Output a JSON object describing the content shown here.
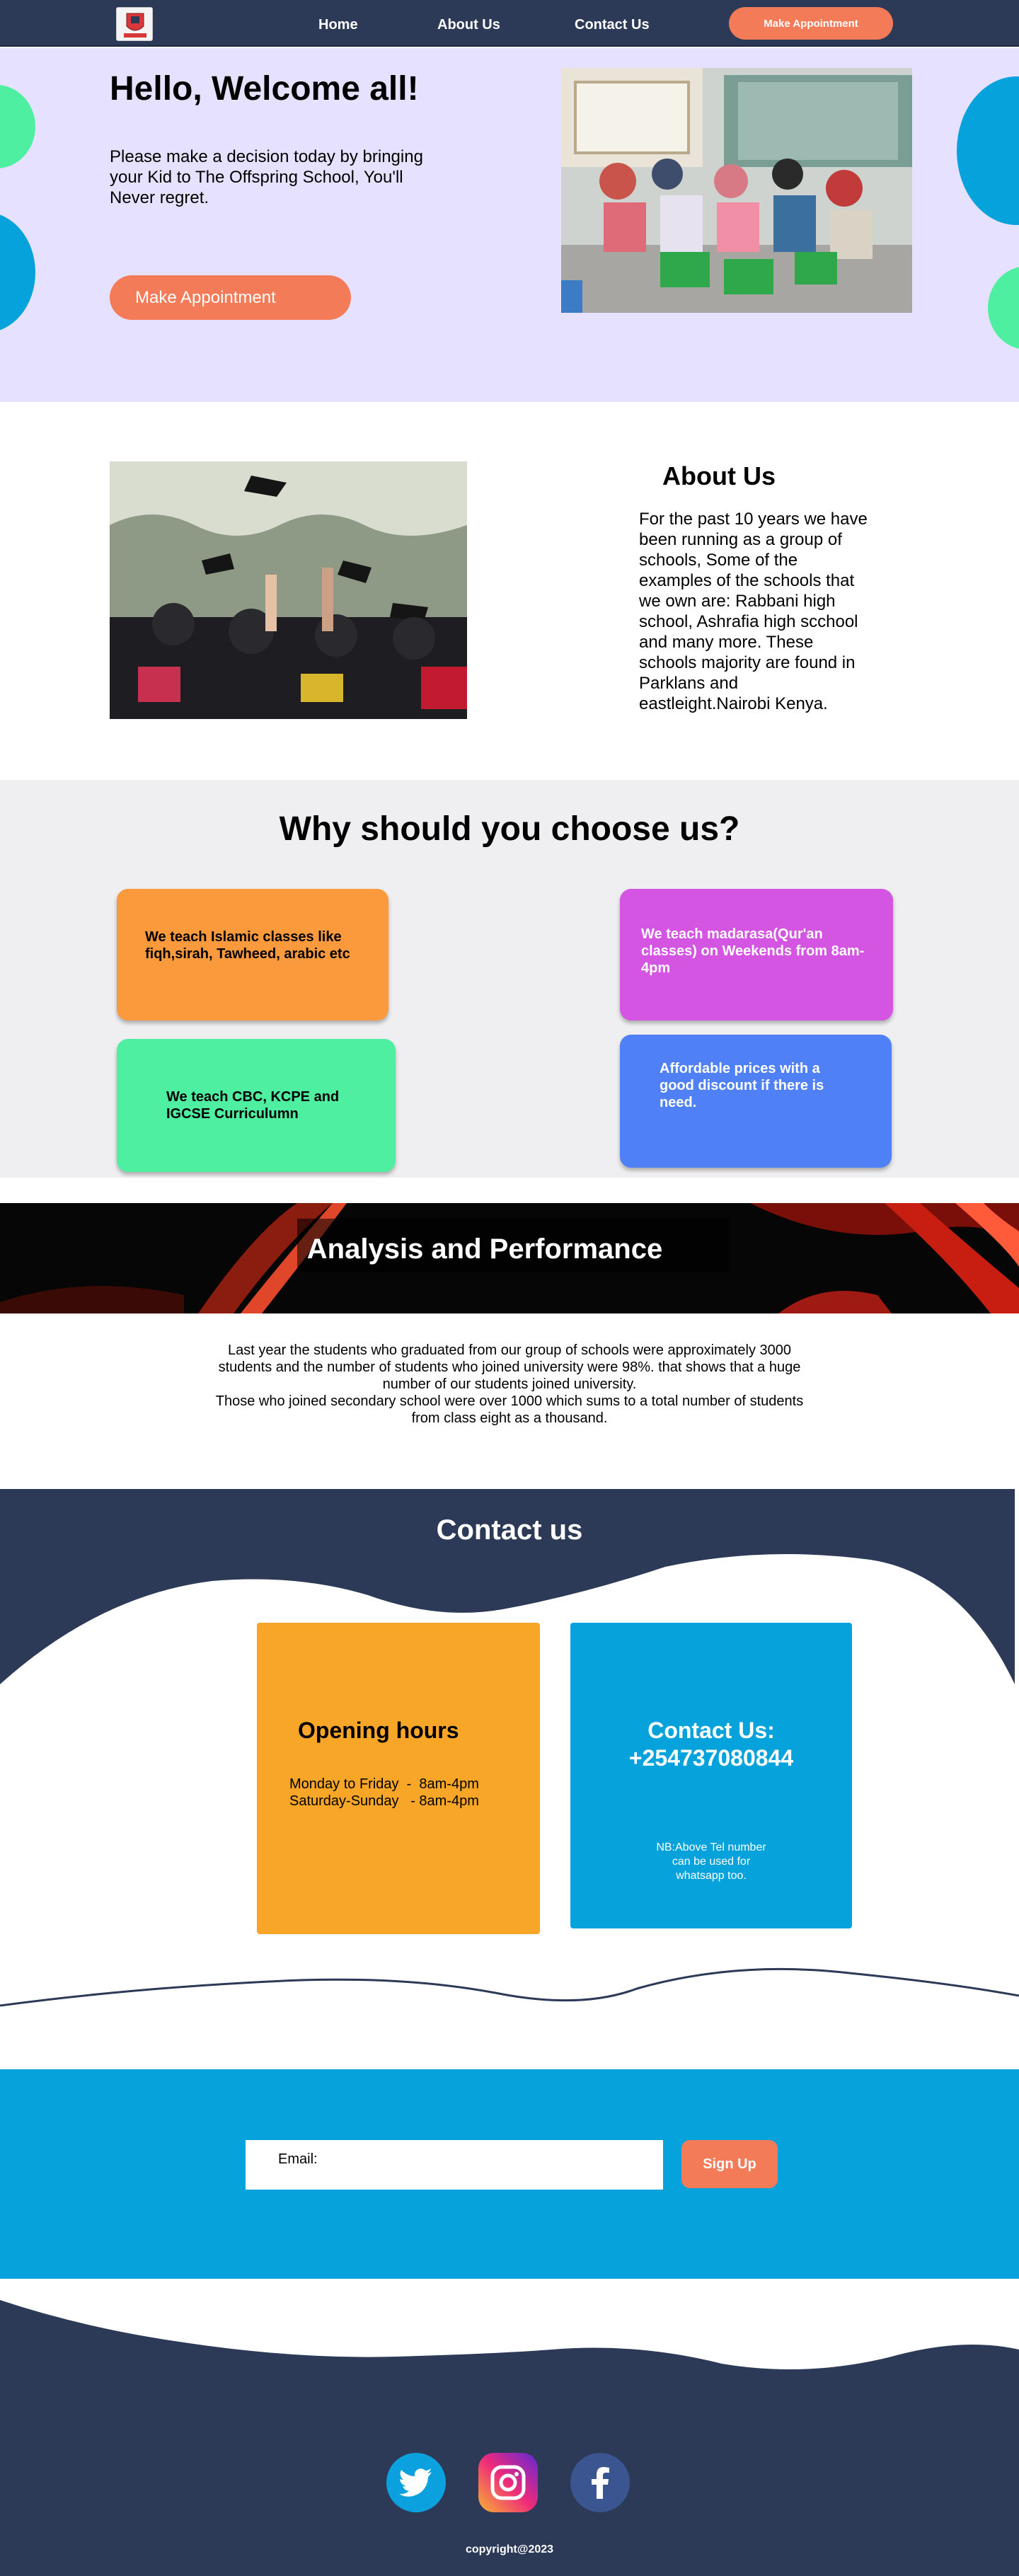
{
  "nav": {
    "home": "Home",
    "about": "About Us",
    "contact": "Contact Us",
    "appointment": "Make Appointment"
  },
  "hero": {
    "title": "Hello, Welcome all!",
    "text": "Please make a decision today by bringing your Kid to The Offspring School, You'll Never regret.",
    "button": "Make Appointment"
  },
  "about": {
    "title": "About Us",
    "text": "For the past 10 years we have been running as a group of schools, Some of the examples of the schools that we own are: Rabbani high school, Ashrafia high scchool and many more. These schools majority are found in Parklans and eastleight.Nairobi Kenya."
  },
  "why": {
    "title": "Why should you choose us?",
    "cards": [
      "We teach Islamic classes like fiqh,sirah, Tawheed, arabic etc",
      "We teach madarasa(Qur'an classes) on Weekends from 8am-4pm",
      "We teach CBC, KCPE and IGCSE Curriculumn",
      "Affordable prices with a good discount if there is need."
    ],
    "colors": [
      "#fb9a3c",
      "#d455e2",
      "#4fefa2",
      "#4f80f6"
    ]
  },
  "analysis": {
    "title": "Analysis and Performance",
    "text1": "Last year the students who graduated from our group of schools were approximately 3000 students and the number of students who joined university were 98%. that shows that a huge number of our students joined university.",
    "text2": "Those who joined secondary school were over 1000 which sums to a total number of students from class eight as a thousand."
  },
  "contact": {
    "title": "Contact us",
    "hours_title": "Opening hours",
    "hours_line1": "Monday to Friday  -  8am-4pm",
    "hours_line2": "Saturday-Sunday   - 8am-4pm",
    "phone_title": "Contact Us:",
    "phone": "+254737080844",
    "note": "NB:Above Tel number can be used for whatsapp too."
  },
  "signup": {
    "email_label": "Email:",
    "button": "Sign Up"
  },
  "footer": {
    "icons": [
      "twitter-icon",
      "instagram-icon",
      "facebook-icon"
    ],
    "copyright": "copyright@2023"
  },
  "colors": {
    "navy": "#2c3a57",
    "accent": "#f47b57",
    "hero_bg": "#e6e1ff",
    "cyan": "#06a2dc",
    "green": "#4fefa2"
  }
}
